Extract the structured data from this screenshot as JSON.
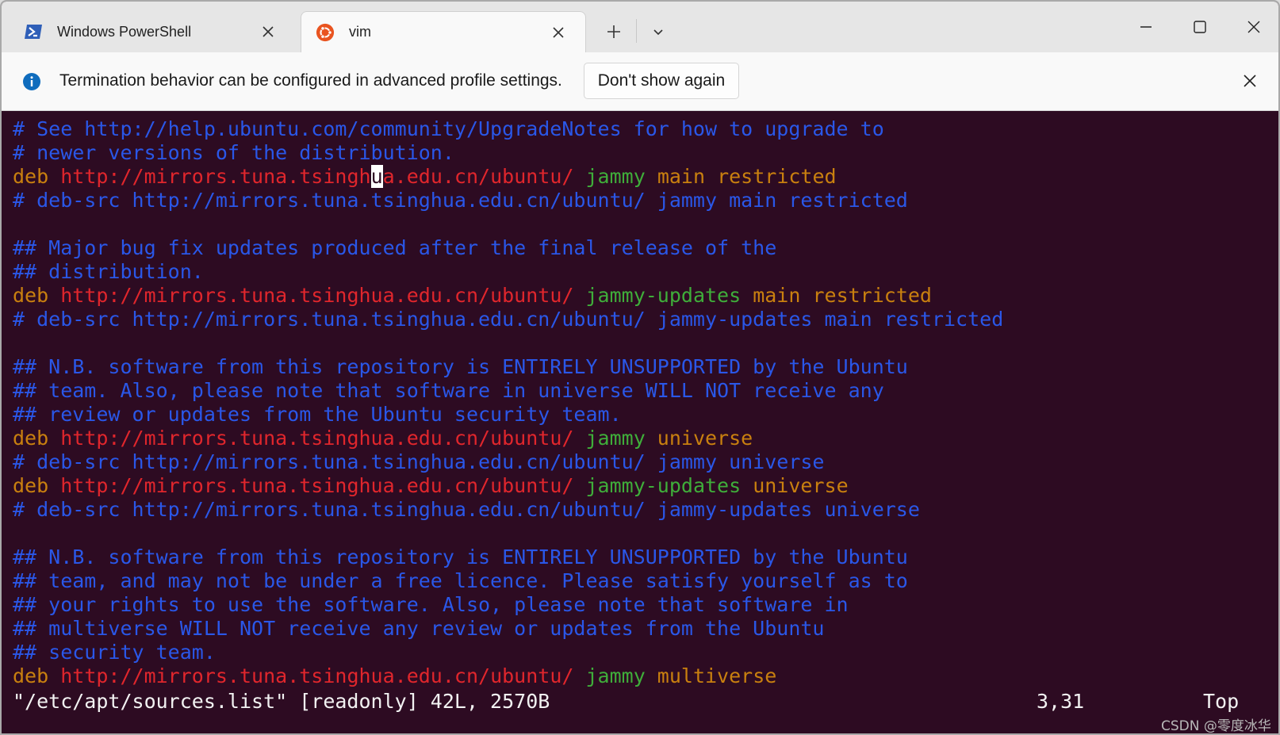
{
  "tabs": [
    {
      "label": "Windows PowerShell",
      "icon": "powershell-icon"
    },
    {
      "label": "vim",
      "icon": "ubuntu-icon"
    }
  ],
  "infobar": {
    "message": "Termination behavior can be configured in advanced profile settings.",
    "dont_show_label": "Don't show again"
  },
  "colors": {
    "background": "#2d0b22",
    "comment": "#2a57e8",
    "keyword": "#c9800f",
    "url": "#e0262c",
    "distribution": "#3fae3a"
  },
  "editor": {
    "lines": [
      [
        {
          "t": "# See http://help.ubuntu.com/community/UpgradeNotes for how to upgrade to",
          "c": "comment"
        }
      ],
      [
        {
          "t": "# newer versions of the distribution.",
          "c": "comment"
        }
      ],
      [
        {
          "t": "deb ",
          "c": "deb"
        },
        {
          "t": "http://mirrors.tuna.tsingh",
          "c": "url"
        },
        {
          "t": "u",
          "c": "cursor"
        },
        {
          "t": "a.edu.cn/ubuntu/",
          "c": "url"
        },
        {
          "t": " jammy",
          "c": "dist"
        },
        {
          "t": " main restricted",
          "c": "comp"
        }
      ],
      [
        {
          "t": "# deb-src http://mirrors.tuna.tsinghua.edu.cn/ubuntu/ jammy main restricted",
          "c": "comment"
        }
      ],
      [],
      [
        {
          "t": "## Major bug fix updates produced after the final release of the",
          "c": "comment"
        }
      ],
      [
        {
          "t": "## distribution.",
          "c": "comment"
        }
      ],
      [
        {
          "t": "deb ",
          "c": "deb"
        },
        {
          "t": "http://mirrors.tuna.tsinghua.edu.cn/ubuntu/",
          "c": "url"
        },
        {
          "t": " jammy-updates",
          "c": "dist"
        },
        {
          "t": " main restricted",
          "c": "comp"
        }
      ],
      [
        {
          "t": "# deb-src http://mirrors.tuna.tsinghua.edu.cn/ubuntu/ jammy-updates main restricted",
          "c": "comment"
        }
      ],
      [],
      [
        {
          "t": "## N.B. software from this repository is ENTIRELY UNSUPPORTED by the Ubuntu",
          "c": "comment"
        }
      ],
      [
        {
          "t": "## team. Also, please note that software in universe WILL NOT receive any",
          "c": "comment"
        }
      ],
      [
        {
          "t": "## review or updates from the Ubuntu security team.",
          "c": "comment"
        }
      ],
      [
        {
          "t": "deb ",
          "c": "deb"
        },
        {
          "t": "http://mirrors.tuna.tsinghua.edu.cn/ubuntu/",
          "c": "url"
        },
        {
          "t": " jammy",
          "c": "dist"
        },
        {
          "t": " universe",
          "c": "comp"
        }
      ],
      [
        {
          "t": "# deb-src http://mirrors.tuna.tsinghua.edu.cn/ubuntu/ jammy universe",
          "c": "comment"
        }
      ],
      [
        {
          "t": "deb ",
          "c": "deb"
        },
        {
          "t": "http://mirrors.tuna.tsinghua.edu.cn/ubuntu/",
          "c": "url"
        },
        {
          "t": " jammy-updates",
          "c": "dist"
        },
        {
          "t": " universe",
          "c": "comp"
        }
      ],
      [
        {
          "t": "# deb-src http://mirrors.tuna.tsinghua.edu.cn/ubuntu/ jammy-updates universe",
          "c": "comment"
        }
      ],
      [],
      [
        {
          "t": "## N.B. software from this repository is ENTIRELY UNSUPPORTED by the Ubuntu",
          "c": "comment"
        }
      ],
      [
        {
          "t": "## team, and may not be under a free licence. Please satisfy yourself as to",
          "c": "comment"
        }
      ],
      [
        {
          "t": "## your rights to use the software. Also, please note that software in",
          "c": "comment"
        }
      ],
      [
        {
          "t": "## multiverse WILL NOT receive any review or updates from the Ubuntu",
          "c": "comment"
        }
      ],
      [
        {
          "t": "## security team.",
          "c": "comment"
        }
      ],
      [
        {
          "t": "deb ",
          "c": "deb"
        },
        {
          "t": "http://mirrors.tuna.tsinghua.edu.cn/ubuntu/",
          "c": "url"
        },
        {
          "t": " jammy",
          "c": "dist"
        },
        {
          "t": " multiverse",
          "c": "comp"
        }
      ]
    ]
  },
  "statusline": {
    "file": "\"/etc/apt/sources.list\" [readonly] 42L, 2570B",
    "position": "3,31",
    "scroll": "Top"
  },
  "watermark": "CSDN @零度冰华"
}
